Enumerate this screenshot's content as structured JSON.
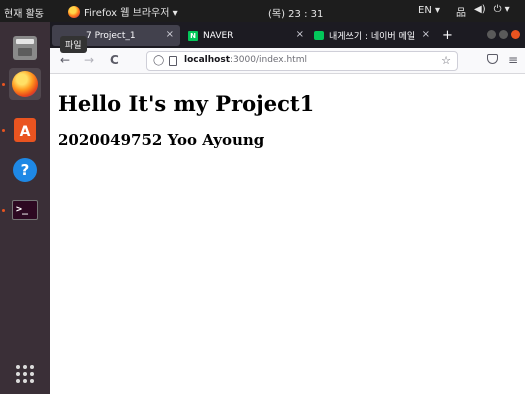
{
  "topbar": {
    "activities": "현재 활동",
    "app_name": "Firefox 웹 브라우저 ▾",
    "clock": "(목) 23 : 31",
    "language": "EN ▾",
    "tray_network": "品",
    "tray_sound": "◀)",
    "tray_power": "⏻ ▾"
  },
  "dock": {
    "items": [
      "files-icon",
      "firefox-icon",
      "software-store-icon",
      "help-icon",
      "terminal-icon",
      "show-apps-icon"
    ],
    "store_glyph": "A",
    "help_glyph": "?",
    "terminal_glyph": ">_",
    "tooltip": "파일"
  },
  "browser": {
    "tabs": [
      {
        "label": "7 Project_1",
        "close": "×",
        "active": true
      },
      {
        "label": "NAVER",
        "close": "×",
        "active": false
      },
      {
        "label": "내게쓰기 : 네이버 메일",
        "close": "×",
        "active": false
      }
    ],
    "naver_favicon": "N",
    "new_tab": "+",
    "nav": {
      "back": "←",
      "forward": "→",
      "reload": "C",
      "menu": "≡"
    },
    "url": {
      "host": "localhost",
      "rest": ":3000/index.html"
    },
    "shield": "◯",
    "star": "☆"
  },
  "page": {
    "heading": "Hello It's my Project1",
    "subheading": "2020049752 Yoo Ayoung"
  },
  "colors": {
    "accent": "#e95420",
    "dock_bg": "#3a2f37",
    "tabbar_bg": "#1c1b22"
  }
}
